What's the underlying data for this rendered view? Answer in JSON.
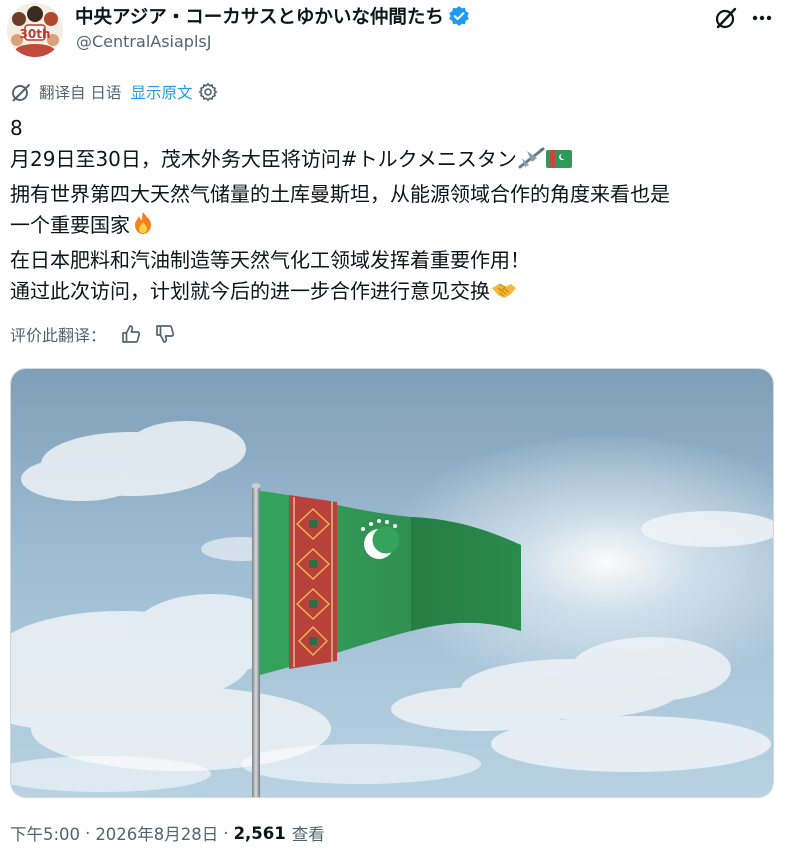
{
  "author": {
    "display_name": "中央アジア・コーカサスとゆかいな仲間たち",
    "handle": "@CentralAsiaplsJ",
    "avatar_badge": "30th",
    "verified": true
  },
  "translation": {
    "translated_from": "翻译自 日语",
    "show_original": "显示原文"
  },
  "tweet": {
    "lines": [
      "8",
      "月29日至30日，茂木外务大臣将访问#トルクメニスタン",
      "拥有世界第四大天然气储量的土库曼斯坦，从能源领域合作的角度来看也是",
      "一个重要国家",
      "在日本肥料和汽油制造等天然气化工领域发挥着重要作用！",
      "通过此次访问，计划就今后的进一步合作进行意见交换"
    ]
  },
  "rating": {
    "label": "评价此翻译："
  },
  "meta": {
    "time": "下午5:00",
    "date": "2026年8月28日",
    "views_count": "2,561",
    "views_label": "查看",
    "separator": "·"
  },
  "icons": {
    "grok": "grok-icon",
    "more": "more-icon",
    "translate": "translate-icon",
    "settings": "gear-icon",
    "like": "thumbs-up-icon",
    "dislike": "thumbs-down-icon"
  },
  "colors": {
    "link": "#1d9bf0",
    "secondary": "#536471",
    "primary_text": "#0f1419",
    "flag_green": "#2e9a57",
    "flag_red": "#c8473f"
  }
}
